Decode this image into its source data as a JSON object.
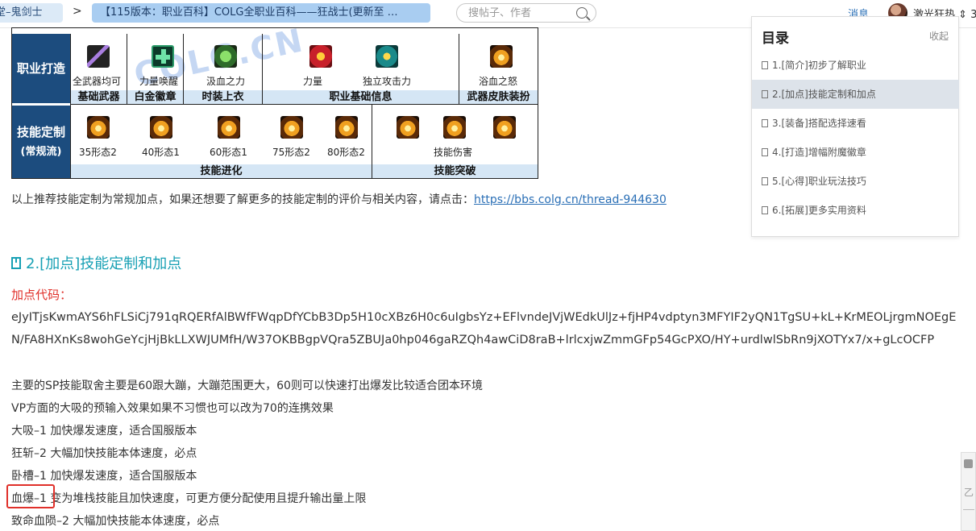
{
  "topbar": {
    "crumb_forum": "堂–鬼剑士",
    "crumb_sep": ">",
    "crumb_thread": "【115版本：职业百科】COLG全职业百科——狂战士(更新至 …",
    "search_placeholder": "搜帖子、作者",
    "messages": "消息",
    "username": "激光狂热 ⇕ 3"
  },
  "table": {
    "watermark": "COLG.CN",
    "row1_header": "职业打造",
    "row1_items": [
      {
        "label": "全武器均可",
        "icon": "sword-icon"
      },
      {
        "label": "力量唤醒",
        "icon": "cross-icon"
      },
      {
        "label": "汲血之力",
        "icon": "green-flame-icon"
      },
      {
        "label": "力量",
        "icon": "red-emblem-icon"
      },
      {
        "label": "独立攻击力",
        "icon": "teal-emblem-icon"
      },
      {
        "label": "浴血之怒",
        "icon": "fire-burst-icon"
      }
    ],
    "row1_bands": [
      "基础武器",
      "白金徽章",
      "时装上衣",
      "职业基础信息",
      "武器皮肤装扮"
    ],
    "row2_header_1": "技能定制",
    "row2_header_2": "(常规流)",
    "row2_items": [
      "35形态2",
      "40形态1",
      "60形态1",
      "75形态2",
      "80形态2"
    ],
    "row2_right_label": "技能伤害",
    "row2_bands": [
      "技能进化",
      "技能突破"
    ]
  },
  "content": {
    "intro_text": "以上推荐技能定制为常规加点，如果还想要了解更多的技能定制的评价与相关内容，请点击：",
    "intro_link": "https://bbs.colg.cn/thread-944630",
    "section_title": "2.[加点]技能定制和加点",
    "code_label": "加点代码：",
    "code": "eJyITjsKwmAYS6hFLSiCj791qRQERfAlBWfFWqpDfYCbB3Dp5H10cXBz6H0c6uIgbsYz+EFlvndeJVjWEdkUlJz+fjHP4vdptyn3MFYIF2yQN1TgSU+kL+KrMEOLjrgmNOEgEN/FA8HXnKs8wohGeYcjHjBkLLXWJUMfH/W37OKBBgpVQra5ZBUJa0hp046gaRZQh4awCiD8raB+lrlcxjwZmmGFp54GcPXO/HY+urdlwlSbRn9jXOTYx7/x+gLcOCFP",
    "lines": [
      "主要的SP技能取舍主要是60跟大蹦，大蹦范围更大，60则可以快速打出爆发比较适合团本环境",
      "VP方面的大吸的预输入效果如果不习惯也可以改为70的连携效果",
      "大吸–1 加快爆发速度，适合国服版本",
      "狂斩–2 大幅加快技能本体速度，必点",
      "卧槽–1 加快爆发速度，适合国服版本",
      "血爆–1 变为堆栈技能且加快速度，可更方便分配使用且提升输出量上限",
      "致命血陨–2 大幅加快技能本体速度，必点"
    ]
  },
  "toc": {
    "title": "目录",
    "collapse": "收起",
    "items": [
      "1.[简介]初步了解职业",
      "2.[加点]技能定制和加点",
      "3.[装备]搭配选择速看",
      "4.[打造]增幅附魔徽章",
      "5.[心得]职业玩法技巧",
      "6.[拓展]更多实用资料"
    ]
  },
  "side_widget": {
    "char": "乙"
  }
}
